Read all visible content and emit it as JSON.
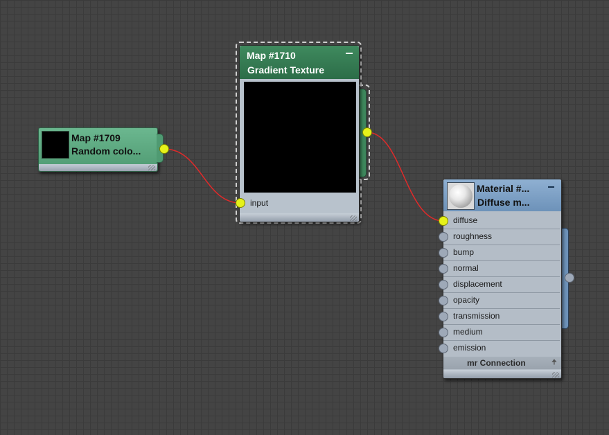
{
  "nodes": {
    "map1709": {
      "title": "Map #1709",
      "subtitle": "Random colo..."
    },
    "map1710": {
      "title": "Map #1710",
      "subtitle": "Gradient Texture",
      "minimize_symbol": "–",
      "input_label": "input"
    },
    "material": {
      "title": "Material #...",
      "subtitle": "Diffuse m...",
      "minimize_symbol": "–",
      "inputs": [
        {
          "label": "diffuse",
          "connected": true
        },
        {
          "label": "roughness",
          "connected": false
        },
        {
          "label": "bump",
          "connected": false
        },
        {
          "label": "normal",
          "connected": false
        },
        {
          "label": "displacement",
          "connected": false
        },
        {
          "label": "opacity",
          "connected": false
        },
        {
          "label": "transmission",
          "connected": false
        },
        {
          "label": "medium",
          "connected": false
        },
        {
          "label": "emission",
          "connected": false
        }
      ],
      "connection_label": "mr Connection",
      "connection_arrow": "🠉"
    }
  },
  "colors": {
    "canvas": "#444444",
    "wire": "#e02a2a",
    "socket_active": "#e6f21a",
    "socket_idle": "#9ea9b8",
    "map_header": "#3f8a5e",
    "material_header": "#8fb0d2"
  }
}
